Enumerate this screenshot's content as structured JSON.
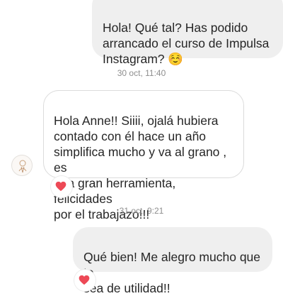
{
  "messages": [
    {
      "direction": "sent",
      "text": "Hola! Qué tal? Has podido\narrancado el curso de Impulsa\nInstagram? ☺️"
    },
    {
      "direction": "received",
      "text": "Hola Anne!! Siiii, ojalá hubiera\ncontado con él hace un año\nsimplifica mucho y va al grano , es\nuna gran herramienta, felicidades\npor el trabajazo!!!",
      "reaction": "heart"
    },
    {
      "direction": "sent",
      "text": "Qué bien! Me alegro mucho que te\nsea de utilidad!!",
      "reaction": "heart"
    }
  ],
  "timestamps": [
    "30 oct, 11:40",
    "31 oct, 9:21"
  ],
  "icons": {
    "reaction": "heart-icon",
    "avatar": "contact-avatar"
  },
  "colors": {
    "sent_bubble": "#efefef",
    "received_border": "#dbdbdb",
    "timestamp": "#8e8e8e",
    "heart": "#ed4956"
  }
}
